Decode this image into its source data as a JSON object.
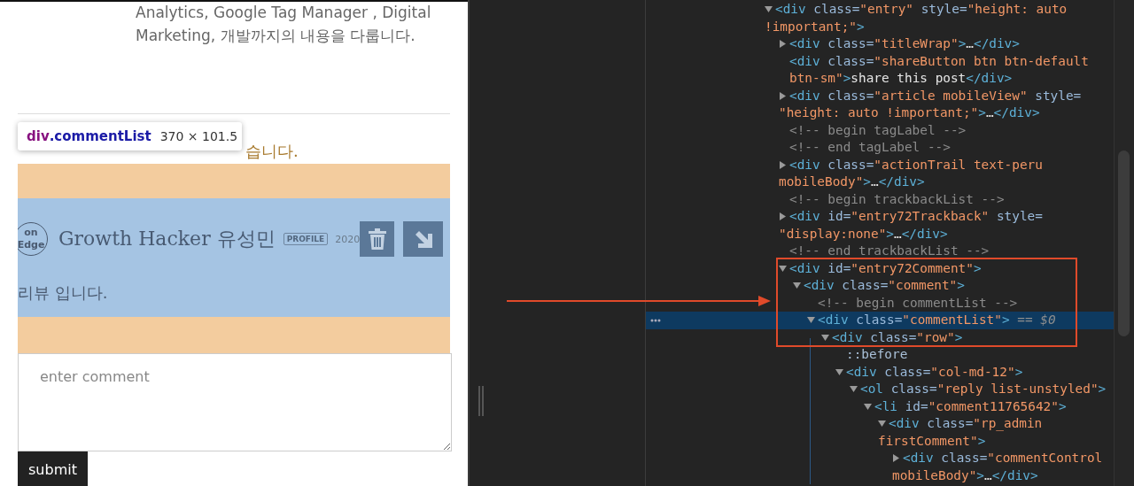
{
  "blog_page": {
    "intro_lines": [
      "Analytics, Google Tag Manager , Digital",
      "Marketing, 개발까지의 내용을 다룹니다."
    ],
    "comment_summary": "습니다.",
    "inspect_tooltip": {
      "selector": "div.commentList",
      "size": "370 × 101.5"
    },
    "comment": {
      "badge": "on Edge",
      "author": "Growth Hacker 유성민",
      "profile_tag": "PROFILE",
      "date": "2020",
      "body": "리뷰 입니다."
    },
    "comment_form": {
      "placeholder": "enter comment",
      "submit": "submit"
    }
  },
  "devtools": {
    "elements_tree": [
      {
        "kind": "element",
        "expanded": true,
        "selected": false,
        "lines": [
          [
            {
              "kind": "tag",
              "text": "<div"
            },
            {
              "kind": "attr",
              "text": " class="
            },
            {
              "kind": "value",
              "text": "\"entry\""
            },
            {
              "kind": "attr",
              "text": " style="
            },
            {
              "kind": "value",
              "text": "\"height: auto"
            }
          ],
          [
            {
              "kind": "value",
              "text": "!important;\""
            },
            {
              "kind": "tag",
              "text": ">"
            }
          ]
        ],
        "children": [
          {
            "kind": "element",
            "expanded": false,
            "selected": false,
            "lines": [
              [
                {
                  "kind": "tag",
                  "text": "<div"
                },
                {
                  "kind": "attr",
                  "text": " class="
                },
                {
                  "kind": "value",
                  "text": "\"titleWrap\""
                },
                {
                  "kind": "tag",
                  "text": ">"
                },
                {
                  "kind": "text",
                  "text": "…"
                },
                {
                  "kind": "tag",
                  "text": "</div>"
                }
              ]
            ]
          },
          {
            "kind": "leaf",
            "selected": false,
            "lines": [
              [
                {
                  "kind": "tag",
                  "text": "<div"
                },
                {
                  "kind": "attr",
                  "text": " class="
                },
                {
                  "kind": "value",
                  "text": "\"shareButton btn btn-default"
                }
              ],
              [
                {
                  "kind": "value",
                  "text": "btn-sm\""
                },
                {
                  "kind": "tag",
                  "text": ">"
                },
                {
                  "kind": "text",
                  "text": "share this post"
                },
                {
                  "kind": "tag",
                  "text": "</div>"
                }
              ]
            ]
          },
          {
            "kind": "element",
            "expanded": false,
            "selected": false,
            "lines": [
              [
                {
                  "kind": "tag",
                  "text": "<div"
                },
                {
                  "kind": "attr",
                  "text": " class="
                },
                {
                  "kind": "value",
                  "text": "\"article mobileView\""
                },
                {
                  "kind": "attr",
                  "text": " style="
                }
              ],
              [
                {
                  "kind": "value",
                  "text": "\"height: auto !important;\""
                },
                {
                  "kind": "tag",
                  "text": ">"
                },
                {
                  "kind": "text",
                  "text": "…"
                },
                {
                  "kind": "tag",
                  "text": "</div>"
                }
              ]
            ]
          },
          {
            "kind": "comment",
            "selected": false,
            "lines": [
              [
                {
                  "kind": "comment",
                  "text": "<!-- begin tagLabel -->"
                }
              ]
            ]
          },
          {
            "kind": "comment",
            "selected": false,
            "lines": [
              [
                {
                  "kind": "comment",
                  "text": "<!-- end tagLabel -->"
                }
              ]
            ]
          },
          {
            "kind": "element",
            "expanded": false,
            "selected": false,
            "lines": [
              [
                {
                  "kind": "tag",
                  "text": "<div"
                },
                {
                  "kind": "attr",
                  "text": " class="
                },
                {
                  "kind": "value",
                  "text": "\"actionTrail text-peru"
                }
              ],
              [
                {
                  "kind": "value",
                  "text": "mobileBody\""
                },
                {
                  "kind": "tag",
                  "text": ">"
                },
                {
                  "kind": "text",
                  "text": "…"
                },
                {
                  "kind": "tag",
                  "text": "</div>"
                }
              ]
            ]
          },
          {
            "kind": "comment",
            "selected": false,
            "lines": [
              [
                {
                  "kind": "comment",
                  "text": "<!-- begin trackbackList -->"
                }
              ]
            ]
          },
          {
            "kind": "element",
            "expanded": false,
            "selected": false,
            "lines": [
              [
                {
                  "kind": "tag",
                  "text": "<div"
                },
                {
                  "kind": "attr",
                  "text": " id="
                },
                {
                  "kind": "value",
                  "text": "\"entry72Trackback\""
                },
                {
                  "kind": "attr",
                  "text": " style="
                }
              ],
              [
                {
                  "kind": "value",
                  "text": "\"display:none\""
                },
                {
                  "kind": "tag",
                  "text": ">"
                },
                {
                  "kind": "text",
                  "text": "…"
                },
                {
                  "kind": "tag",
                  "text": "</div>"
                }
              ]
            ]
          },
          {
            "kind": "comment",
            "selected": false,
            "lines": [
              [
                {
                  "kind": "comment",
                  "text": "<!-- end trackbackList -->"
                }
              ]
            ]
          },
          {
            "kind": "element",
            "expanded": true,
            "selected": false,
            "lines": [
              [
                {
                  "kind": "tag",
                  "text": "<div"
                },
                {
                  "kind": "attr",
                  "text": " id="
                },
                {
                  "kind": "value",
                  "text": "\"entry72Comment\""
                },
                {
                  "kind": "tag",
                  "text": ">"
                }
              ]
            ],
            "children": [
              {
                "kind": "element",
                "expanded": true,
                "selected": false,
                "lines": [
                  [
                    {
                      "kind": "tag",
                      "text": "<div"
                    },
                    {
                      "kind": "attr",
                      "text": " class="
                    },
                    {
                      "kind": "value",
                      "text": "\"comment\""
                    },
                    {
                      "kind": "tag",
                      "text": ">"
                    }
                  ]
                ],
                "children": [
                  {
                    "kind": "comment",
                    "selected": false,
                    "lines": [
                      [
                        {
                          "kind": "comment",
                          "text": "<!-- begin commentList -->"
                        }
                      ]
                    ]
                  },
                  {
                    "kind": "element",
                    "expanded": true,
                    "selected": true,
                    "lines": [
                      [
                        {
                          "kind": "tag",
                          "text": "<div"
                        },
                        {
                          "kind": "attr",
                          "text": " class="
                        },
                        {
                          "kind": "value",
                          "text": "\"commentList\""
                        },
                        {
                          "kind": "tag",
                          "text": ">"
                        },
                        {
                          "kind": "marker",
                          "text": " == $0"
                        }
                      ]
                    ],
                    "children": [
                      {
                        "kind": "element",
                        "expanded": true,
                        "selected": false,
                        "lines": [
                          [
                            {
                              "kind": "tag",
                              "text": "<div"
                            },
                            {
                              "kind": "attr",
                              "text": " class="
                            },
                            {
                              "kind": "value",
                              "text": "\"row\""
                            },
                            {
                              "kind": "tag",
                              "text": ">"
                            }
                          ]
                        ],
                        "children": [
                          {
                            "kind": "pseudo",
                            "selected": false,
                            "lines": [
                              [
                                {
                                  "kind": "pseudo",
                                  "text": "::before"
                                }
                              ]
                            ]
                          },
                          {
                            "kind": "element",
                            "expanded": true,
                            "selected": false,
                            "lines": [
                              [
                                {
                                  "kind": "tag",
                                  "text": "<div"
                                },
                                {
                                  "kind": "attr",
                                  "text": " class="
                                },
                                {
                                  "kind": "value",
                                  "text": "\"col-md-12\""
                                },
                                {
                                  "kind": "tag",
                                  "text": ">"
                                }
                              ]
                            ],
                            "children": [
                              {
                                "kind": "element",
                                "expanded": true,
                                "selected": false,
                                "lines": [
                                  [
                                    {
                                      "kind": "tag",
                                      "text": "<ol"
                                    },
                                    {
                                      "kind": "attr",
                                      "text": " class="
                                    },
                                    {
                                      "kind": "value",
                                      "text": "\"reply list-unstyled\""
                                    },
                                    {
                                      "kind": "tag",
                                      "text": ">"
                                    }
                                  ]
                                ],
                                "children": [
                                  {
                                    "kind": "element",
                                    "expanded": true,
                                    "selected": false,
                                    "lines": [
                                      [
                                        {
                                          "kind": "tag",
                                          "text": "<li"
                                        },
                                        {
                                          "kind": "attr",
                                          "text": " id="
                                        },
                                        {
                                          "kind": "value",
                                          "text": "\"comment11765642\""
                                        },
                                        {
                                          "kind": "tag",
                                          "text": ">"
                                        }
                                      ]
                                    ],
                                    "children": [
                                      {
                                        "kind": "element",
                                        "expanded": true,
                                        "selected": false,
                                        "lines": [
                                          [
                                            {
                                              "kind": "tag",
                                              "text": "<div"
                                            },
                                            {
                                              "kind": "attr",
                                              "text": " class="
                                            },
                                            {
                                              "kind": "value",
                                              "text": "\"rp_admin"
                                            }
                                          ],
                                          [
                                            {
                                              "kind": "value",
                                              "text": "firstComment\""
                                            },
                                            {
                                              "kind": "tag",
                                              "text": ">"
                                            }
                                          ]
                                        ],
                                        "children": [
                                          {
                                            "kind": "element",
                                            "expanded": false,
                                            "selected": false,
                                            "lines": [
                                              [
                                                {
                                                  "kind": "tag",
                                                  "text": "<div"
                                                },
                                                {
                                                  "kind": "attr",
                                                  "text": " class="
                                                },
                                                {
                                                  "kind": "value",
                                                  "text": "\"commentControl"
                                                }
                                              ],
                                              [
                                                {
                                                  "kind": "value",
                                                  "text": "mobileBody\""
                                                },
                                                {
                                                  "kind": "tag",
                                                  "text": ">"
                                                },
                                                {
                                                  "kind": "text",
                                                  "text": "…"
                                                },
                                                {
                                                  "kind": "tag",
                                                  "text": "</div>"
                                                }
                                              ]
                                            ]
                                          }
                                        ]
                                      }
                                    ]
                                  }
                                ]
                              }
                            ]
                          }
                        ]
                      }
                    ]
                  }
                ]
              }
            ]
          }
        ]
      }
    ]
  }
}
